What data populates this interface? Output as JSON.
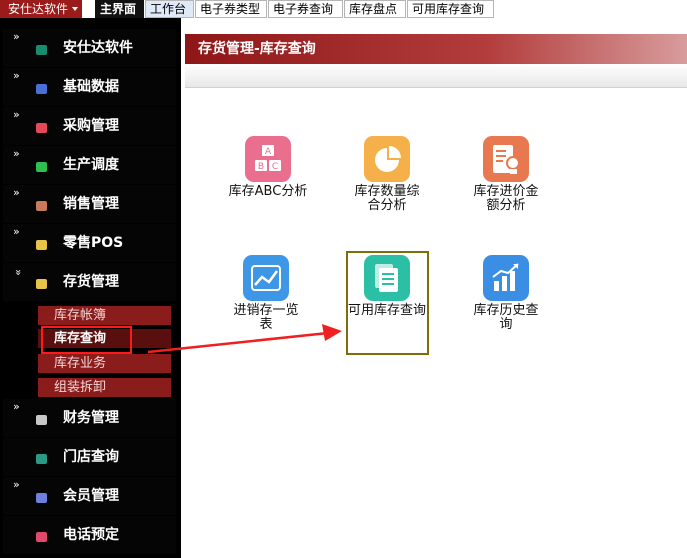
{
  "topbar": {
    "brand": "安仕达软件",
    "tabs": [
      "主界面",
      "工作台",
      "电子券类型",
      "电子券查询",
      "库存盘点",
      "可用库存查询"
    ]
  },
  "sidebar": {
    "items": [
      {
        "label": "安仕达软件",
        "icon": "cube-icon",
        "color": "#1a8c6e"
      },
      {
        "label": "基础数据",
        "icon": "database-icon",
        "color": "#4c6fd6"
      },
      {
        "label": "采购管理",
        "icon": "cart-icon",
        "color": "#e4495a"
      },
      {
        "label": "生产调度",
        "icon": "factory-icon",
        "color": "#2fbf4f"
      },
      {
        "label": "销售管理",
        "icon": "sales-icon",
        "color": "#c87a5a"
      },
      {
        "label": "零售POS",
        "icon": "pos-icon",
        "color": "#e8c34a"
      },
      {
        "label": "存货管理",
        "icon": "inventory-icon",
        "color": "#e8c34a"
      },
      {
        "label": "财务管理",
        "icon": "finance-icon",
        "color": "#c8c8c8"
      },
      {
        "label": "门店查询",
        "icon": "store-icon",
        "color": "#2a9a86"
      },
      {
        "label": "会员管理",
        "icon": "member-icon",
        "color": "#6e7fe0"
      },
      {
        "label": "电话预定",
        "icon": "phone-icon",
        "color": "#e04a6a"
      }
    ],
    "subitems": [
      "库存帐簿",
      "库存查询",
      "库存业务",
      "组装拆卸"
    ]
  },
  "content": {
    "title": "存货管理-库存查询",
    "tiles": [
      {
        "label": "库存ABC分析",
        "icon": "abc-icon",
        "color": "#ea6f8f"
      },
      {
        "label": "库存数量综合分析",
        "icon": "pie-chart-icon",
        "color": "#f5b04a"
      },
      {
        "label": "库存进价金额分析",
        "icon": "report-icon",
        "color": "#e8784f"
      },
      {
        "label": "进销存一览表",
        "icon": "line-chart-icon",
        "color": "#3e97e6"
      },
      {
        "label": "可用库存查询",
        "icon": "document-icon",
        "color": "#2bbfa5"
      },
      {
        "label": "库存历史查询",
        "icon": "bar-chart-icon",
        "color": "#3a8fe4"
      }
    ]
  }
}
